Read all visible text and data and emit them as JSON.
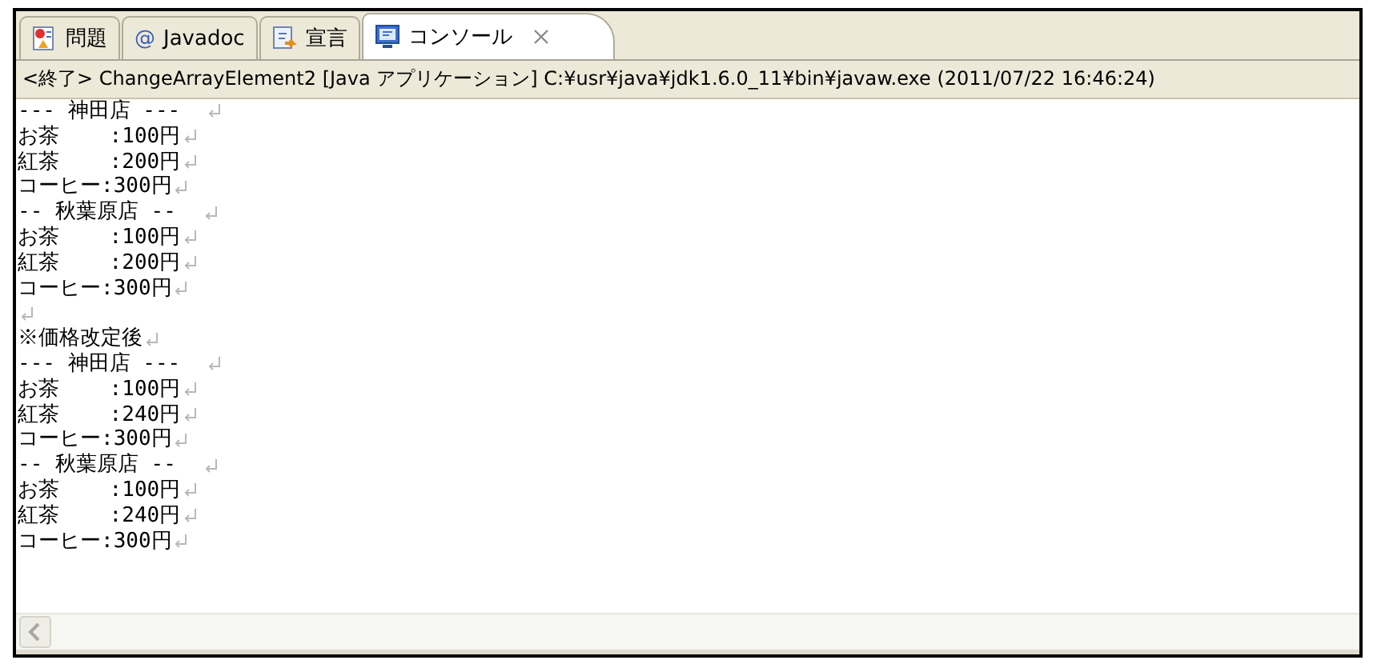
{
  "tabs": [
    {
      "label": "問題",
      "selected": false
    },
    {
      "label": "Javadoc",
      "icon_text": "@",
      "selected": false
    },
    {
      "label": "宣言",
      "selected": false
    },
    {
      "label": "コンソール",
      "selected": true
    }
  ],
  "console": {
    "header": "<終了> ChangeArrayElement2 [Java アプリケーション] C:¥usr¥java¥jdk1.6.0_11¥bin¥javaw.exe (2011/07/22 16:46:24)",
    "lines": [
      {
        "kind": "text",
        "text": "--- 神田店 ---  "
      },
      {
        "kind": "text",
        "text": "お茶    :100円"
      },
      {
        "kind": "text",
        "text": "紅茶    :200円"
      },
      {
        "kind": "text",
        "text": "コーヒー:300円"
      },
      {
        "kind": "text",
        "text": "-- 秋葉原店 --  "
      },
      {
        "kind": "text",
        "text": "お茶    :100円"
      },
      {
        "kind": "text",
        "text": "紅茶    :200円"
      },
      {
        "kind": "text",
        "text": "コーヒー:300円"
      },
      {
        "kind": "blank"
      },
      {
        "kind": "text",
        "text": "※価格改定後"
      },
      {
        "kind": "text",
        "text": "--- 神田店 ---  "
      },
      {
        "kind": "text",
        "text": "お茶    :100円"
      },
      {
        "kind": "text",
        "text": "紅茶    :240円"
      },
      {
        "kind": "text",
        "text": "コーヒー:300円"
      },
      {
        "kind": "text",
        "text": "-- 秋葉原店 --  "
      },
      {
        "kind": "text",
        "text": "お茶    :100円"
      },
      {
        "kind": "text",
        "text": "紅茶    :240円"
      },
      {
        "kind": "text",
        "text": "コーヒー:300円"
      }
    ]
  }
}
